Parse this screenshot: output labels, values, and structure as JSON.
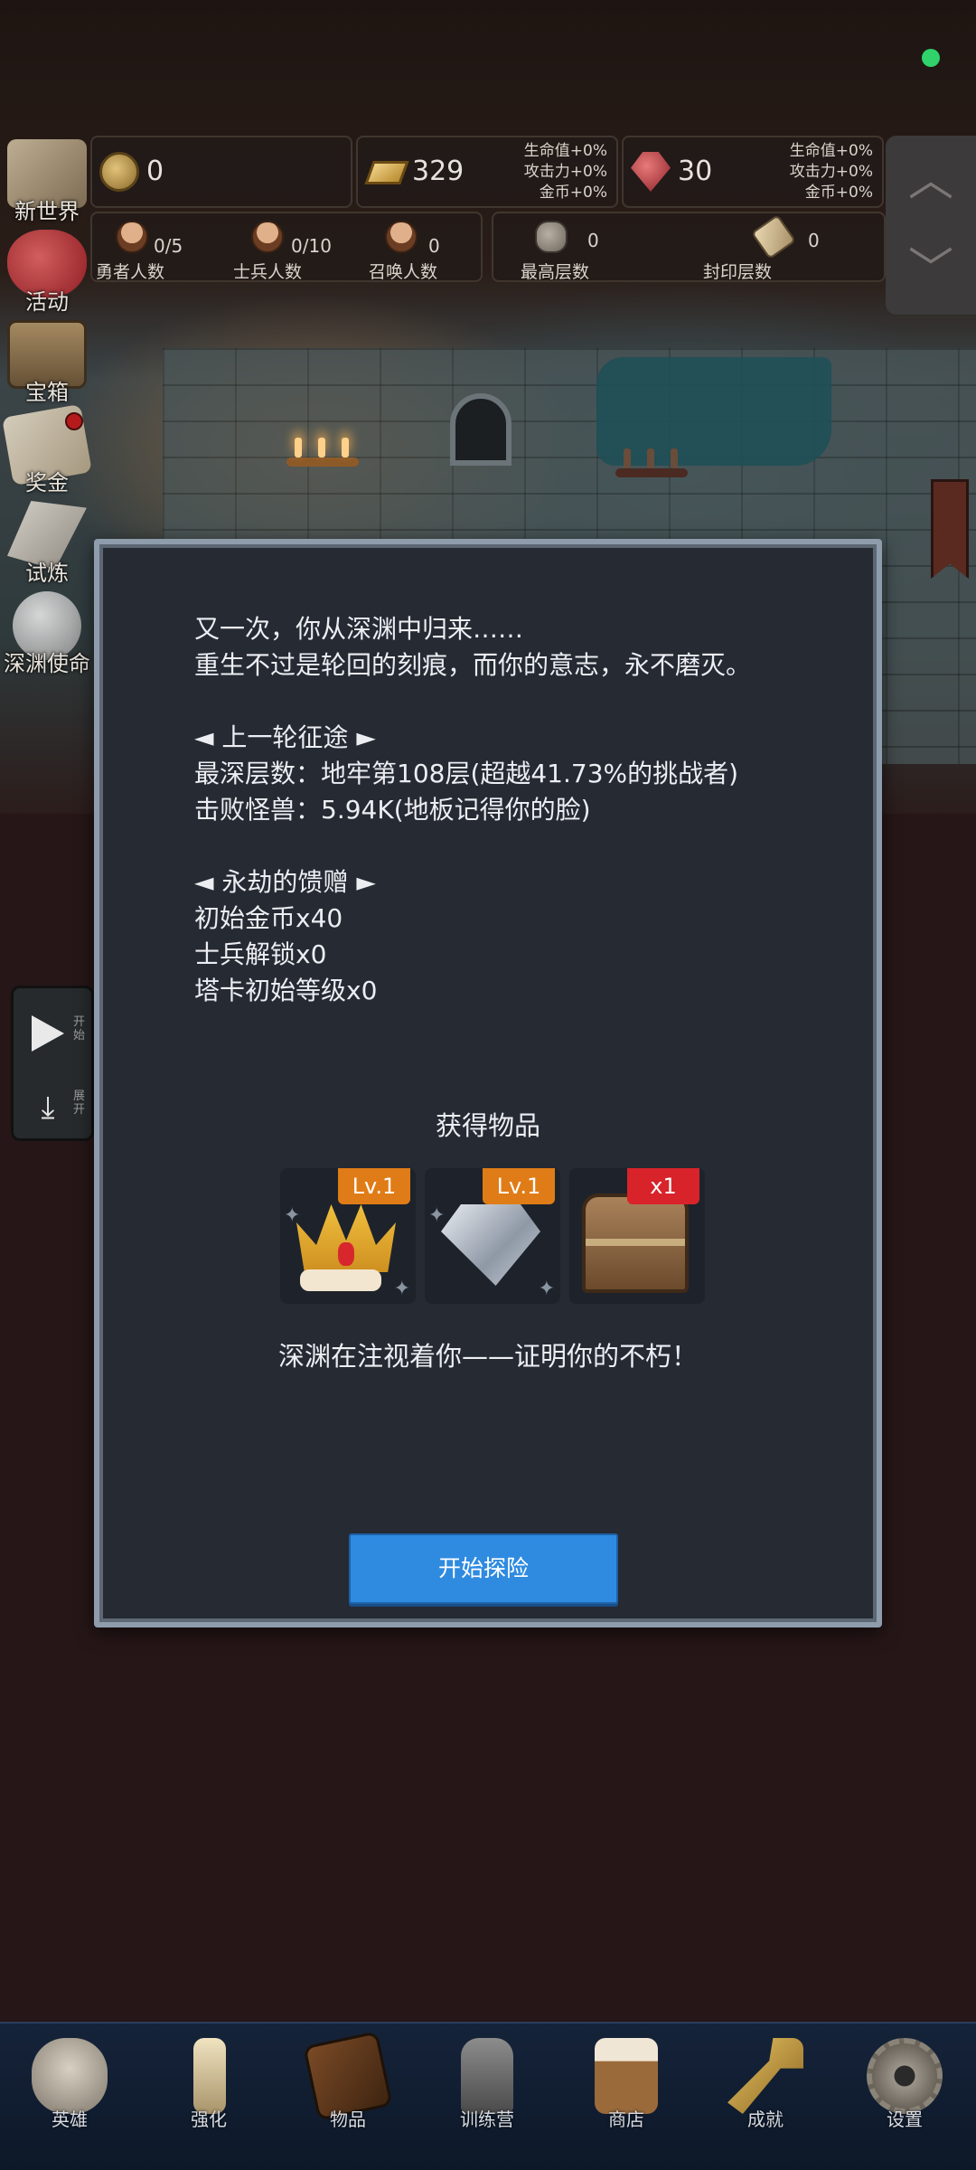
{
  "resources": {
    "coin": {
      "value": "0"
    },
    "gold": {
      "value": "329",
      "bonus": [
        "生命值+0%",
        "攻击力+0%",
        "金币+0%"
      ]
    },
    "gem": {
      "value": "30",
      "bonus": [
        "生命值+0%",
        "攻击力+0%",
        "金币+0%"
      ]
    }
  },
  "stats": {
    "heroes": {
      "value": "0/5",
      "label": "勇者人数"
    },
    "soldiers": {
      "value": "0/10",
      "label": "士兵人数"
    },
    "summons": {
      "value": "0",
      "label": "召唤人数"
    },
    "max_floor": {
      "value": "0",
      "label": "最高层数"
    },
    "sealed_floor": {
      "value": "0",
      "label": "封印层数"
    }
  },
  "scroll_controls": {
    "up": "︿",
    "down": "﹀"
  },
  "side_menu": [
    {
      "label": "新世界",
      "icon": "map-icon"
    },
    {
      "label": "活动",
      "icon": "heart-icon"
    },
    {
      "label": "宝箱",
      "icon": "chest-icon"
    },
    {
      "label": "奖金",
      "icon": "letter-icon"
    },
    {
      "label": "试炼",
      "icon": "quill-icon"
    },
    {
      "label": "深渊使命",
      "icon": "orb-icon"
    }
  ],
  "play_control": {
    "start_small": "开始",
    "expand_small": "展开",
    "collapse_glyph": "⤓"
  },
  "dialog": {
    "lines": [
      "又一次，你从深渊中归来……",
      "重生不过是轮回的刻痕，而你的意志，永不磨灭。",
      "",
      "◄ 上一轮征途 ►",
      "最深层数：地牢第108层(超越41.73%的挑战者)",
      "击败怪兽：5.94K(地板记得你的脸)",
      "",
      "◄ 永劫的馈赠 ►",
      "初始金币x40",
      "士兵解锁x0",
      "塔卡初始等级x0"
    ],
    "rewards_title": "获得物品",
    "items": [
      {
        "icon": "crown-icon",
        "tag": "Lv.1"
      },
      {
        "icon": "diamond-icon",
        "tag": "Lv.1"
      },
      {
        "icon": "chest-icon",
        "tag": "x1"
      }
    ],
    "abyss_line": "深渊在注视着你——证明你的不朽！",
    "start_button": "开始探险"
  },
  "bottom_nav": [
    {
      "label": "英雄",
      "icon": "skull-icon"
    },
    {
      "label": "强化",
      "icon": "candle-icon"
    },
    {
      "label": "物品",
      "icon": "book-icon"
    },
    {
      "label": "训练营",
      "icon": "lantern-icon"
    },
    {
      "label": "商店",
      "icon": "mug-icon"
    },
    {
      "label": "成就",
      "icon": "key-icon"
    },
    {
      "label": "设置",
      "icon": "gear-icon"
    }
  ],
  "colors": {
    "dialog_bg": "#252a33",
    "dialog_border": "#8e9cac",
    "button_blue": "#2f8be0",
    "tag_orange": "#e07c17",
    "tag_red": "#d8232a",
    "status_dot": "#2fd26b",
    "nav_bg": "#15233a"
  }
}
